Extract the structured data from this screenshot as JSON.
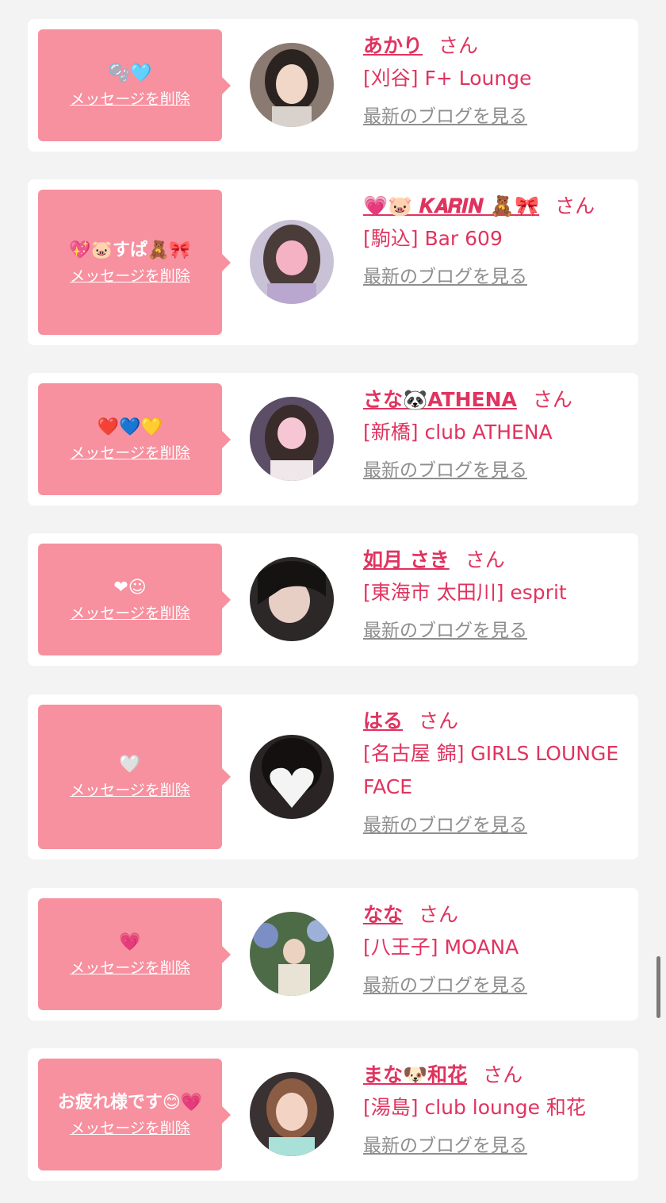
{
  "delete_label": "メッセージを削除",
  "blog_label": "最新のブログを見る",
  "san_label": "さん",
  "colors": {
    "bubble": "#f7909f",
    "accent": "#e0335f",
    "link_gray": "#8e8e8e",
    "background": "#f3f3f3"
  },
  "cards": [
    {
      "message": "🫧🩵",
      "name": "あかり",
      "shop": "[刈谷] F+ Lounge",
      "avatar_icon": "avatar-photo"
    },
    {
      "message": "💖🐷すぱ🧸🎀",
      "name": "💗🐷 𝑲𝑨𝑹𝑰𝑵 🧸🎀",
      "shop": "[駒込] Bar 609",
      "avatar_icon": "avatar-photo"
    },
    {
      "message": "❤️💙💛",
      "name": "さな🐼ATHENA",
      "shop": "[新橋] club ATHENA",
      "avatar_icon": "avatar-photo"
    },
    {
      "message": "❤︎☺︎",
      "name": "如月 さき",
      "shop": "[東海市 太田川] esprit",
      "avatar_icon": "avatar-photo"
    },
    {
      "message": "🤍",
      "name": "はる",
      "shop": "[名古屋 錦] GIRLS LOUNGE FACE",
      "avatar_icon": "avatar-photo"
    },
    {
      "message": "💗",
      "name": "なな",
      "shop": "[八王子] MOANA",
      "avatar_icon": "avatar-photo"
    },
    {
      "message": "お疲れ様です😊💗",
      "name": "まな🐶和花",
      "shop": "[湯島] club lounge 和花",
      "avatar_icon": "avatar-photo"
    }
  ]
}
